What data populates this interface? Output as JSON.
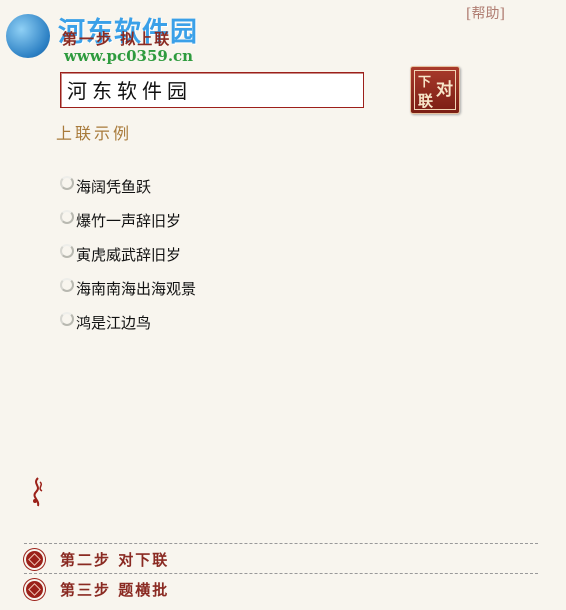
{
  "watermark": {
    "title": "河东软件园",
    "url": "www.pc0359.cn"
  },
  "help_label": "[帮助]",
  "step1": {
    "title": "第一步 拟上联"
  },
  "input": {
    "value": "河东软件园"
  },
  "submit_seal": {
    "chars": [
      "下",
      "对",
      "联"
    ]
  },
  "examples": {
    "title": "上联示例",
    "items": [
      "海阔凭鱼跃",
      "爆竹一声辞旧岁",
      "寅虎威武辞旧岁",
      "海南南海出海观景",
      "鸿是江边鸟"
    ]
  },
  "steps": [
    {
      "label": "第二步 对下联"
    },
    {
      "label": "第三步 题横批"
    }
  ],
  "colors": {
    "accent": "#8a2a22",
    "seal": "#9b2119",
    "background": "#f8f5ee",
    "watermark_blue": "#3aa0e8",
    "watermark_green": "#2e9b3e"
  }
}
